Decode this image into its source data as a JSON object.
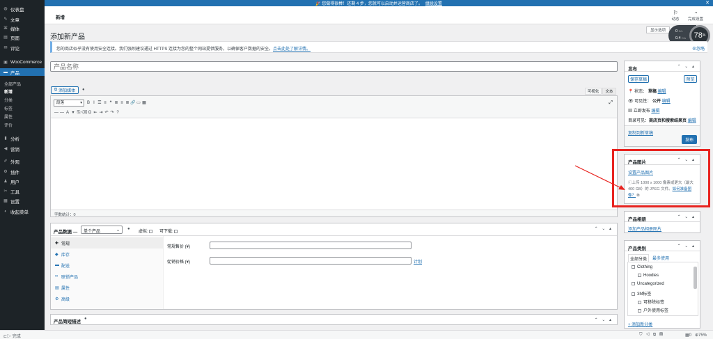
{
  "notice": {
    "text": "🎉 您做得很棒！还剩 4 步，您就可以启动并运营商店了。",
    "link": "继续设置"
  },
  "sidebar": {
    "items": [
      {
        "icon": "dashboard-icon",
        "glyph": "◍",
        "label": "仪表盘"
      },
      {
        "icon": "pin-icon",
        "glyph": "✎",
        "label": "文章"
      },
      {
        "icon": "media-icon",
        "glyph": "⌘",
        "label": "媒体"
      },
      {
        "icon": "pages-icon",
        "glyph": "▤",
        "label": "页面"
      },
      {
        "icon": "comments-icon",
        "glyph": "✉",
        "label": "评论"
      },
      {
        "icon": "woocommerce-icon",
        "glyph": "▣",
        "label": "WooCommerce"
      },
      {
        "icon": "products-icon",
        "glyph": "▬",
        "label": "产品"
      },
      {
        "icon": "analytics-icon",
        "glyph": "▮",
        "label": "分析"
      },
      {
        "icon": "marketing-icon",
        "glyph": "◀",
        "label": "营销"
      },
      {
        "icon": "appearance-icon",
        "glyph": "✐",
        "label": "外观"
      },
      {
        "icon": "plugins-icon",
        "glyph": "⚙",
        "label": "插件"
      },
      {
        "icon": "users-icon",
        "glyph": "♟",
        "label": "用户"
      },
      {
        "icon": "tools-icon",
        "glyph": "✂",
        "label": "工具"
      },
      {
        "icon": "settings-icon",
        "glyph": "▦",
        "label": "设置"
      },
      {
        "icon": "collapse-icon",
        "glyph": "◐",
        "label": "收起菜单"
      }
    ],
    "sub": [
      "全部产品",
      "新增",
      "分类",
      "标签",
      "属性",
      "评价"
    ]
  },
  "topbar": {
    "breadcrumb": "新增",
    "activity": "动态",
    "finish_setup": "完成设置",
    "screen_options": "显示选项",
    "speed": "78",
    "speed_unit": "%",
    "net_up": "0",
    "net_down": "0.4",
    "net_unit": "K/s"
  },
  "page": {
    "title": "添加新产品",
    "notice": "您的商店似乎没有使用安全连接。我们强烈建议通过 HTTPS 连接为您的整个网站提供服务，以确保客户数据的安全。",
    "notice_link": "点击此处了解详情。",
    "dismiss": "忽略",
    "title_placeholder": "产品名称"
  },
  "editor": {
    "add_media": "添加媒体",
    "tab_visual": "可视化",
    "tab_text": "文本",
    "format_select": "段落",
    "toolbar1": [
      "B",
      "I",
      "☰",
      "≡",
      "❝",
      "≣",
      "≡",
      "≣",
      "🔗",
      "▭",
      "▦"
    ],
    "toolbar2": [
      "—",
      "—",
      "A",
      "▾",
      "⎘",
      "⌫",
      "Ω",
      "⇤",
      "⇥",
      "↶",
      "↷",
      "?"
    ],
    "word_count": "字数统计：0"
  },
  "product_data": {
    "title": "产品数据 —",
    "type": "单个产品",
    "virtual": "虚拟:",
    "downloadable": "可下载:",
    "tabs": [
      {
        "icon": "wrench-icon",
        "glyph": "✚",
        "label": "常规"
      },
      {
        "icon": "inventory-icon",
        "glyph": "◆",
        "label": "库存"
      },
      {
        "icon": "shipping-icon",
        "glyph": "▬",
        "label": "配送"
      },
      {
        "icon": "link-icon",
        "glyph": "∞",
        "label": "联锁产品"
      },
      {
        "icon": "attributes-icon",
        "glyph": "▤",
        "label": "属性"
      },
      {
        "icon": "advanced-icon",
        "glyph": "⚙",
        "label": "高级"
      }
    ],
    "regular_price": "常规售价 (¥)",
    "sale_price": "促销价格 (¥)",
    "schedule": "计划"
  },
  "short_desc": {
    "title": "产品简短描述"
  },
  "publish": {
    "title": "发布",
    "save_draft": "保存草稿",
    "preview": "预览",
    "status_label": "状态：",
    "status_value": "草稿",
    "visibility_label": "可见性：",
    "visibility_value": "公开",
    "publish_label": "立即发布",
    "catalog_label": "目录可见：",
    "catalog_value": "商店页和搜索结果页",
    "edit": "编辑",
    "copy": "复制到新草稿",
    "publish_btn": "发布"
  },
  "product_image": {
    "title": "产品图片",
    "set_link": "设置产品图片",
    "hint": "ⓘ上传 1000 x 1000 像素或更大（最大 400 GB）的 JPEG 文件。",
    "hint_link": "如何准备图像？"
  },
  "gallery": {
    "title": "产品相册",
    "add_link": "添加产品相册图片"
  },
  "categories": {
    "title": "产品类别",
    "tab_all": "全部分类",
    "tab_most": "最多使用",
    "items": [
      {
        "label": "Clothing",
        "level": 0
      },
      {
        "label": "Hoodies",
        "level": 1
      },
      {
        "label": "Uncategorized",
        "level": 0
      },
      {
        "label": "3M标签",
        "level": 0
      },
      {
        "label": "可移除标签",
        "level": 1
      },
      {
        "label": "户外使用标签",
        "level": 1
      }
    ],
    "add_new": "+ 添加新分类"
  },
  "statusbar": {
    "left": "完成",
    "zoom": "75%",
    "counter": "0"
  },
  "colors": {
    "accent": "#2271b1",
    "sidebar": "#1d2327",
    "highlight": "#e8231f"
  }
}
